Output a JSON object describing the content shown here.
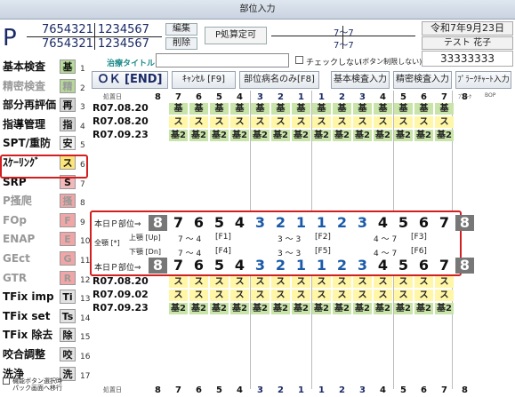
{
  "window": {
    "title": "部位入力"
  },
  "patient": {
    "letter": "P",
    "num1_left": "7654321",
    "num1_right": "1234567",
    "num2_left": "7654321",
    "num2_right": "1234567",
    "edit_label": "編集",
    "delete_label": "削除",
    "p_calc_label": "P処算定可",
    "p_range_top": "7～7",
    "p_range_bottom": "7～7",
    "date": "令和7年9月23日",
    "name": "テスト 花子",
    "id": "33333333"
  },
  "toolbar": {
    "treatment_title_label": "治療タイトル",
    "check_label": "チェックしない",
    "check_note": "(ボタン制限しない)",
    "ok_label": "ＯＫ [END]",
    "cancel_label": "ｷｬﾝｾﾙ [F9]",
    "part_name_label": "部位病名のみ[F8]",
    "basic_input_label": "基本検査入力",
    "precise_input_label": "精密検査入力",
    "plaque_label": "ﾌﾟﾗｰｸﾁｬｰﾄ入力"
  },
  "sidebar": {
    "items": [
      {
        "label": "基本検査",
        "badge": "基",
        "num": "1"
      },
      {
        "label": "精密検査",
        "badge": "精",
        "num": "2"
      },
      {
        "label": "部分再評価",
        "badge": "再",
        "num": "3"
      },
      {
        "label": "指導管理",
        "badge": "指",
        "num": "4"
      },
      {
        "label": "SPT/重防",
        "badge": "安",
        "num": "5"
      },
      {
        "label": "ｽｹｰﾘﾝｸﾞ",
        "badge": "ス",
        "num": "6"
      },
      {
        "label": "SRP",
        "badge": "S",
        "num": "7"
      },
      {
        "label": "P搔爬",
        "badge": "搔",
        "num": "8"
      },
      {
        "label": "FOp",
        "badge": "F",
        "num": "9"
      },
      {
        "label": "ENAP",
        "badge": "E",
        "num": "10"
      },
      {
        "label": "GEct",
        "badge": "G",
        "num": "11"
      },
      {
        "label": "GTR",
        "badge": "R",
        "num": "12"
      },
      {
        "label": "TFix imp",
        "badge": "Ti",
        "num": "13"
      },
      {
        "label": "TFix set",
        "badge": "Ts",
        "num": "14"
      },
      {
        "label": "TFix 除去",
        "badge": "除",
        "num": "15"
      },
      {
        "label": "咬合調整",
        "badge": "咬",
        "num": "16"
      },
      {
        "label": "洗浄",
        "badge": "洗",
        "num": "17"
      }
    ],
    "footer_check": "機能ボタン選択時",
    "footer_check2": "パック画面へ移行"
  },
  "grid": {
    "header_label": "処置日",
    "teeth_top": [
      "8",
      "7",
      "6",
      "5",
      "4",
      "3",
      "2",
      "1",
      "1",
      "2",
      "3",
      "4",
      "5",
      "6",
      "7",
      "8"
    ],
    "plaque": "ﾌﾟﾗｰｸ",
    "bop": "BOP",
    "pct": "%",
    "top_rows": [
      {
        "date": "R07.08.20",
        "cells": [
          "",
          "基",
          "基",
          "基",
          "基",
          "基",
          "基",
          "基",
          "基",
          "基",
          "基",
          "基",
          "基",
          "基",
          "基",
          ""
        ]
      },
      {
        "date": "R07.08.20",
        "cells": [
          "",
          "ス",
          "ス",
          "ス",
          "ス",
          "ス",
          "ス",
          "ス",
          "ス",
          "ス",
          "ス",
          "ス",
          "ス",
          "ス",
          "ス",
          ""
        ]
      },
      {
        "date": "R07.09.23",
        "cells": [
          "",
          "基2",
          "基2",
          "基2",
          "基2",
          "基2",
          "基2",
          "基2",
          "基2",
          "基2",
          "基2",
          "基2",
          "基2",
          "基2",
          "基2",
          ""
        ]
      }
    ],
    "bottom_rows": [
      {
        "date": "R07.08.20",
        "cells": [
          "",
          "ス",
          "ス",
          "ス",
          "ス",
          "ス",
          "ス",
          "ス",
          "ス",
          "ス",
          "ス",
          "ス",
          "ス",
          "ス",
          "ス",
          ""
        ]
      },
      {
        "date": "R07.09.02",
        "cells": [
          "",
          "ス",
          "ス",
          "ス",
          "ス",
          "ス",
          "ス",
          "ス",
          "ス",
          "ス",
          "ス",
          "ス",
          "ス",
          "ス",
          "ス",
          ""
        ]
      },
      {
        "date": "R07.09.23",
        "cells": [
          "",
          "基2",
          "基2",
          "基2",
          "基2",
          "基2",
          "基2",
          "基2",
          "基2",
          "基2",
          "基2",
          "基2",
          "基2",
          "基2",
          "基2",
          ""
        ]
      }
    ]
  },
  "selector": {
    "today_label": "本日Ｐ部位⇒",
    "teeth": [
      "8",
      "7",
      "6",
      "5",
      "4",
      "3",
      "2",
      "1",
      "1",
      "2",
      "3",
      "4",
      "5",
      "6",
      "7",
      "8"
    ],
    "all_label": "全顎 [*]",
    "upper_label": "上顎 [Up]",
    "lower_label": "下顎 [Dn]",
    "upper": [
      {
        "text": "7 ～ 4",
        "key": "[F1]"
      },
      {
        "text": "3 ～ 3",
        "key": "[F2]"
      },
      {
        "text": "4 ～ 7",
        "key": "[F3]"
      }
    ],
    "lower": [
      {
        "text": "7 ～ 4",
        "key": "[F4]"
      },
      {
        "text": "3 ～ 3",
        "key": "[F5]"
      },
      {
        "text": "4 ～ 7",
        "key": "[F6]"
      }
    ]
  }
}
